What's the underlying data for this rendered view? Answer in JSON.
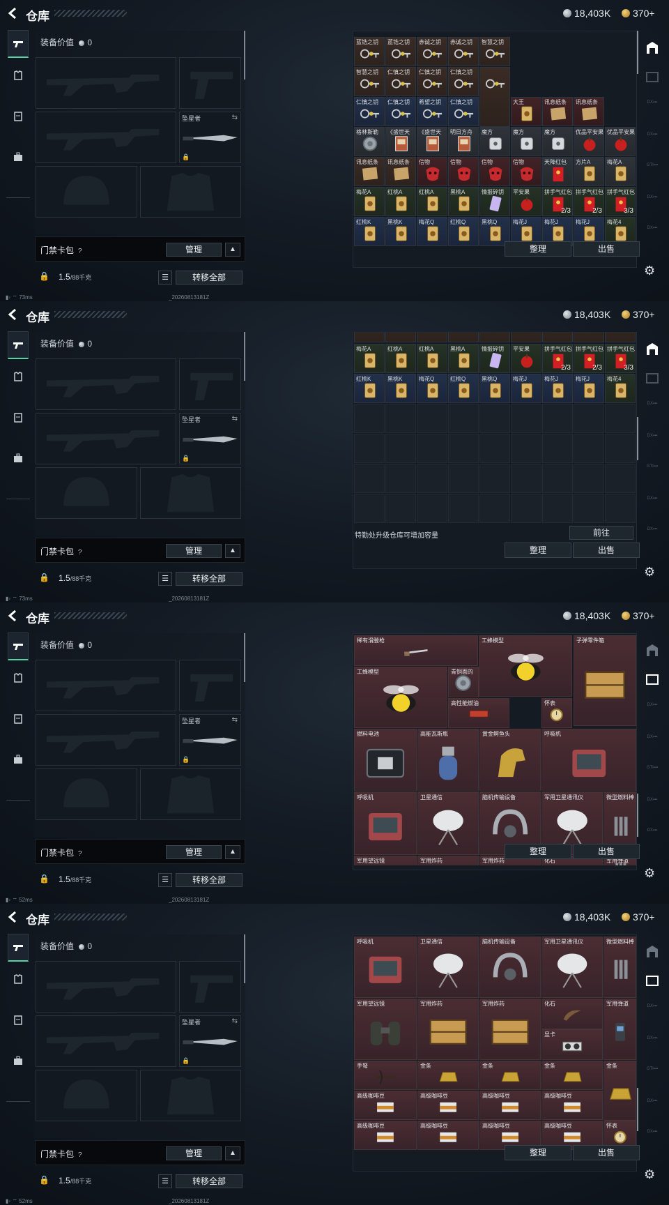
{
  "header": {
    "title": "仓库",
    "silver": "18,403K",
    "gold": "370+"
  },
  "loadout": {
    "equip_value_label": "装备价值",
    "equip_value": "0",
    "melee_label": "坠星者"
  },
  "bag": {
    "label": "门禁卡包",
    "manage": "管理"
  },
  "footer": {
    "weight": "1.5",
    "weight_max": "/88千克",
    "transfer": "转移全部"
  },
  "storage": {
    "sort": "整理",
    "sell": "出售",
    "upgrade_msg": "特勤处升级仓库可增加容量",
    "goto": "前往"
  },
  "status": {
    "ping_a": "73ms",
    "ping_b": "52ms",
    "stamp": "_20260813181Z"
  },
  "grid1": [
    {
      "n": "蓝锆之钥",
      "c": "brn",
      "i": "key"
    },
    {
      "n": "蓝锆之钥",
      "c": "brn",
      "i": "key"
    },
    {
      "n": "赤诚之钥",
      "c": "brn",
      "i": "key"
    },
    {
      "n": "赤诚之钥",
      "c": "brn",
      "i": "key"
    },
    {
      "n": "智慧之钥",
      "c": "brn",
      "i": "key"
    },
    {
      "n": "智慧之钥",
      "c": "brn",
      "i": "key"
    },
    {
      "n": "仁慎之钥",
      "c": "brn",
      "i": "key"
    },
    {
      "n": "仁慎之钥",
      "c": "brn",
      "i": "key"
    },
    {
      "n": "仁慎之钥",
      "c": "brn",
      "i": "key"
    },
    {
      "n": "",
      "c": "brn",
      "i": "key"
    },
    {
      "n": "仁慎之钥",
      "c": "blu",
      "i": "key"
    },
    {
      "n": "仁慎之钥",
      "c": "blu",
      "i": "key"
    },
    {
      "n": "希望之钥",
      "c": "blu",
      "i": "key"
    },
    {
      "n": "仁慎之钥",
      "c": "blu",
      "i": "key"
    },
    {
      "n": "大王",
      "c": "red",
      "i": "card"
    },
    {
      "n": "讯息纸条",
      "c": "red",
      "i": "note"
    },
    {
      "n": "讯息纸条",
      "c": "red",
      "i": "note"
    },
    {
      "n": "格林斯勒",
      "c": "gry",
      "i": "token"
    },
    {
      "n": "《盛世天",
      "c": "gry",
      "i": "book"
    },
    {
      "n": "《盛世天",
      "c": "gry",
      "i": "book"
    },
    {
      "n": "明日方舟",
      "c": "gry",
      "i": "book"
    },
    {
      "n": "魔方",
      "c": "gry",
      "i": "dice"
    },
    {
      "n": "魔方",
      "c": "gry",
      "i": "dice"
    },
    {
      "n": "魔方",
      "c": "gry",
      "i": "dice"
    },
    {
      "n": "优品平安果",
      "c": "gry",
      "i": "apple"
    },
    {
      "n": "优品平安果",
      "c": "gry",
      "i": "apple"
    },
    {
      "n": "讯息纸条",
      "c": "brn",
      "i": "note"
    },
    {
      "n": "讯息纸条",
      "c": "brn",
      "i": "note"
    },
    {
      "n": "信物",
      "c": "red",
      "i": "mask"
    },
    {
      "n": "信物",
      "c": "red",
      "i": "mask"
    },
    {
      "n": "信物",
      "c": "red",
      "i": "mask"
    },
    {
      "n": "信物",
      "c": "red",
      "i": "mask"
    },
    {
      "n": "天降红包",
      "c": "gry",
      "i": "env"
    },
    {
      "n": "方片A",
      "c": "gry",
      "i": "card"
    },
    {
      "n": "梅花A",
      "c": "gry",
      "i": "card"
    },
    {
      "n": "梅花A",
      "c": "grn",
      "i": "card"
    },
    {
      "n": "红桃A",
      "c": "grn",
      "i": "card"
    },
    {
      "n": "红桃A",
      "c": "grn",
      "i": "card"
    },
    {
      "n": "黑桃A",
      "c": "grn",
      "i": "card"
    },
    {
      "n": "情报碎钥",
      "c": "grn",
      "i": "crystal"
    },
    {
      "n": "平安果",
      "c": "grn",
      "i": "apple"
    },
    {
      "n": "拼手气红包",
      "c": "grn",
      "i": "env",
      "q": "2/3"
    },
    {
      "n": "拼手气红包",
      "c": "grn",
      "i": "env",
      "q": "2/3"
    },
    {
      "n": "拼手气红包",
      "c": "grn",
      "i": "env",
      "q": "3/3"
    },
    {
      "n": "红桃K",
      "c": "blu",
      "i": "card"
    },
    {
      "n": "黑桃K",
      "c": "blu",
      "i": "card"
    },
    {
      "n": "梅花Q",
      "c": "blu",
      "i": "card"
    },
    {
      "n": "红桃Q",
      "c": "blu",
      "i": "card"
    },
    {
      "n": "黑桃Q",
      "c": "blu",
      "i": "card"
    },
    {
      "n": "梅花J",
      "c": "blu",
      "i": "card"
    },
    {
      "n": "梅花J",
      "c": "blu",
      "i": "card"
    },
    {
      "n": "梅花J",
      "c": "blu",
      "i": "card"
    },
    {
      "n": "梅花4",
      "c": "grn",
      "i": "card"
    }
  ],
  "grid2": [
    {
      "n": "梅花A",
      "c": "grn",
      "i": "card"
    },
    {
      "n": "红桃A",
      "c": "grn",
      "i": "card"
    },
    {
      "n": "红桃A",
      "c": "grn",
      "i": "card"
    },
    {
      "n": "黑桃A",
      "c": "grn",
      "i": "card"
    },
    {
      "n": "情报碎钥",
      "c": "grn",
      "i": "crystal"
    },
    {
      "n": "平安果",
      "c": "grn",
      "i": "apple"
    },
    {
      "n": "拼手气红包",
      "c": "grn",
      "i": "env",
      "q": "2/3"
    },
    {
      "n": "拼手气红包",
      "c": "grn",
      "i": "env",
      "q": "2/3"
    },
    {
      "n": "拼手气红包",
      "c": "grn",
      "i": "env",
      "q": "3/3"
    },
    {
      "n": "红桃K",
      "c": "blu",
      "i": "card"
    },
    {
      "n": "黑桃K",
      "c": "blu",
      "i": "card"
    },
    {
      "n": "梅花Q",
      "c": "blu",
      "i": "card"
    },
    {
      "n": "红桃Q",
      "c": "blu",
      "i": "card"
    },
    {
      "n": "黑桃Q",
      "c": "blu",
      "i": "card"
    },
    {
      "n": "梅花J",
      "c": "blu",
      "i": "card"
    },
    {
      "n": "梅花J",
      "c": "blu",
      "i": "card"
    },
    {
      "n": "梅花J",
      "c": "blu",
      "i": "card"
    },
    {
      "n": "梅花4",
      "c": "grn",
      "i": "card"
    }
  ],
  "grid3": [
    {
      "n": "稀有滑膛枪",
      "i": "rifle"
    },
    {
      "n": "工蜂模型",
      "i": "bee"
    },
    {
      "n": "子弹零件箱",
      "i": "crate"
    },
    {
      "n": "工蜂模型",
      "i": "bee"
    },
    {
      "n": "青铜面的",
      "i": "token"
    },
    {
      "n": "高性能燃油",
      "i": "brick"
    },
    {
      "n": "怀表",
      "i": "watch"
    },
    {
      "n": "燃料电池",
      "i": "battery"
    },
    {
      "n": "高能瓦斯瓶",
      "i": "gas"
    },
    {
      "n": "黄金鳄鱼头",
      "i": "horse"
    },
    {
      "n": "呼吸机",
      "i": "machine"
    },
    {
      "n": "呼吸机",
      "i": "machine"
    },
    {
      "n": "卫星通信",
      "i": "dish"
    },
    {
      "n": "脑机传输设备",
      "i": "helmet"
    },
    {
      "n": "军用卫星通讯仪",
      "i": "dish"
    },
    {
      "n": "微型燃料棒",
      "i": "rods"
    },
    {
      "n": "军用望远镜",
      "i": "bino"
    },
    {
      "n": "军用炸药",
      "i": "crate"
    },
    {
      "n": "军用炸药",
      "i": "crate"
    },
    {
      "n": "化石",
      "i": "fossil"
    },
    {
      "n": "军用弹道",
      "i": "rods"
    }
  ],
  "grid4": [
    {
      "n": "呼吸机",
      "i": "machine"
    },
    {
      "n": "卫星通信",
      "i": "dish"
    },
    {
      "n": "脑机传输设备",
      "i": "helmet"
    },
    {
      "n": "军用卫星通讯仪",
      "i": "dish"
    },
    {
      "n": "微型燃料棒",
      "i": "rods"
    },
    {
      "n": "军用望远镜",
      "i": "bino"
    },
    {
      "n": "军用炸药",
      "i": "crate"
    },
    {
      "n": "军用炸药",
      "i": "crate"
    },
    {
      "n": "化石",
      "i": "fossil"
    },
    {
      "n": "显卡",
      "i": "gpu"
    },
    {
      "n": "军用弹道",
      "i": "radio"
    },
    {
      "n": "手弩",
      "i": "xbow"
    },
    {
      "n": "金条",
      "i": "gold"
    },
    {
      "n": "金条",
      "i": "gold"
    },
    {
      "n": "金条",
      "i": "gold"
    },
    {
      "n": "金条",
      "i": "gold"
    },
    {
      "n": "高级咖啡豆",
      "i": "coffee"
    },
    {
      "n": "高级咖啡豆",
      "i": "coffee"
    },
    {
      "n": "高级咖啡豆",
      "i": "coffee"
    },
    {
      "n": "高级咖啡豆",
      "i": "coffee"
    },
    {
      "n": "高级咖啡豆",
      "i": "coffee"
    },
    {
      "n": "高级咖啡豆",
      "i": "coffee"
    },
    {
      "n": "高级咖啡豆",
      "i": "coffee"
    },
    {
      "n": "高级咖啡豆",
      "i": "coffee"
    },
    {
      "n": "怀表",
      "i": "watch"
    }
  ]
}
